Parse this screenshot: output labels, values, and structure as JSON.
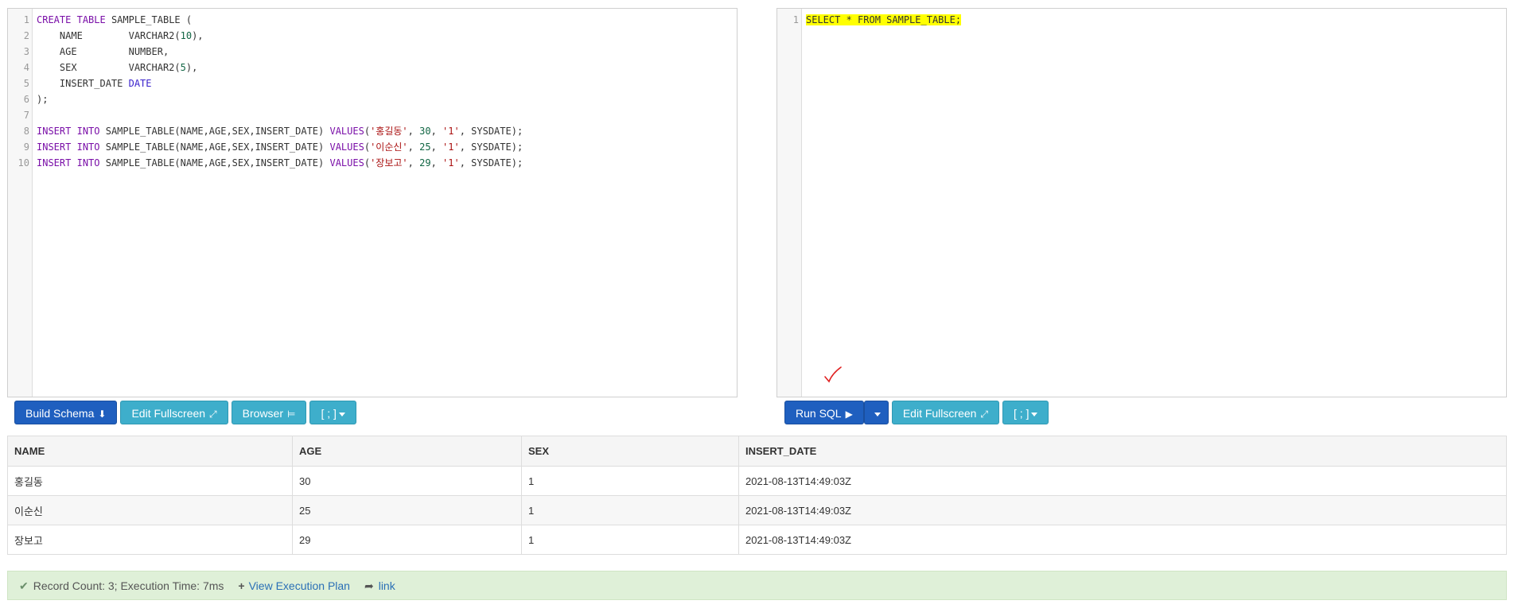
{
  "schema_editor": {
    "lines": [
      [
        [
          "kw",
          "CREATE"
        ],
        [
          "t",
          " "
        ],
        [
          "kw",
          "TABLE"
        ],
        [
          "t",
          " SAMPLE_TABLE ("
        ]
      ],
      [
        [
          "t",
          "    NAME        VARCHAR2("
        ],
        [
          "num",
          "10"
        ],
        [
          "t",
          "),"
        ]
      ],
      [
        [
          "t",
          "    AGE         NUMBER,"
        ]
      ],
      [
        [
          "t",
          "    SEX         VARCHAR2("
        ],
        [
          "num",
          "5"
        ],
        [
          "t",
          "),"
        ]
      ],
      [
        [
          "t",
          "    INSERT_DATE "
        ],
        [
          "dt",
          "DATE"
        ]
      ],
      [
        [
          "t",
          ");"
        ]
      ],
      [
        [
          "t",
          ""
        ]
      ],
      [
        [
          "kw",
          "INSERT"
        ],
        [
          "t",
          " "
        ],
        [
          "kw",
          "INTO"
        ],
        [
          "t",
          " SAMPLE_TABLE(NAME,AGE,SEX,INSERT_DATE) "
        ],
        [
          "kw",
          "VALUES"
        ],
        [
          "t",
          "("
        ],
        [
          "str",
          "'홍길동'"
        ],
        [
          "t",
          ", "
        ],
        [
          "num",
          "30"
        ],
        [
          "t",
          ", "
        ],
        [
          "str",
          "'1'"
        ],
        [
          "t",
          ", SYSDATE);"
        ]
      ],
      [
        [
          "kw",
          "INSERT"
        ],
        [
          "t",
          " "
        ],
        [
          "kw",
          "INTO"
        ],
        [
          "t",
          " SAMPLE_TABLE(NAME,AGE,SEX,INSERT_DATE) "
        ],
        [
          "kw",
          "VALUES"
        ],
        [
          "t",
          "("
        ],
        [
          "str",
          "'이순신'"
        ],
        [
          "t",
          ", "
        ],
        [
          "num",
          "25"
        ],
        [
          "t",
          ", "
        ],
        [
          "str",
          "'1'"
        ],
        [
          "t",
          ", SYSDATE);"
        ]
      ],
      [
        [
          "kw",
          "INSERT"
        ],
        [
          "t",
          " "
        ],
        [
          "kw",
          "INTO"
        ],
        [
          "t",
          " SAMPLE_TABLE(NAME,AGE,SEX,INSERT_DATE) "
        ],
        [
          "kw",
          "VALUES"
        ],
        [
          "t",
          "("
        ],
        [
          "str",
          "'장보고'"
        ],
        [
          "t",
          ", "
        ],
        [
          "num",
          "29"
        ],
        [
          "t",
          ", "
        ],
        [
          "str",
          "'1'"
        ],
        [
          "t",
          ", SYSDATE);"
        ]
      ]
    ]
  },
  "query_editor": {
    "lines": [
      [
        [
          "hl",
          "SELECT * FROM SAMPLE_TABLE;"
        ]
      ]
    ]
  },
  "left_toolbar": {
    "build_schema": "Build Schema",
    "edit_fullscreen": "Edit Fullscreen",
    "browser": "Browser",
    "delimiter": "[ ; ]"
  },
  "right_toolbar": {
    "run_sql": "Run SQL",
    "edit_fullscreen": "Edit Fullscreen",
    "delimiter": "[ ; ]"
  },
  "results": {
    "columns": [
      "NAME",
      "AGE",
      "SEX",
      "INSERT_DATE"
    ],
    "rows": [
      [
        "홍길동",
        "30",
        "1",
        "2021-08-13T14:49:03Z"
      ],
      [
        "이순신",
        "25",
        "1",
        "2021-08-13T14:49:03Z"
      ],
      [
        "장보고",
        "29",
        "1",
        "2021-08-13T14:49:03Z"
      ]
    ]
  },
  "status": {
    "summary": "Record Count: 3; Execution Time: 7ms",
    "view_plan": "View Execution Plan",
    "link": "link"
  },
  "colors": {
    "primary": "#1f5fbf",
    "info": "#3eaecb",
    "highlight": "#ffff00",
    "success_bg": "#dff0d8"
  }
}
